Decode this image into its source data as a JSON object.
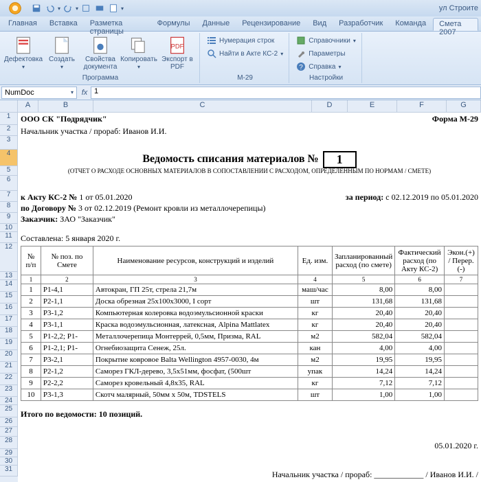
{
  "titlebar": {
    "filename": "ул Строите"
  },
  "tabs": [
    "Главная",
    "Вставка",
    "Разметка страницы",
    "Формулы",
    "Данные",
    "Рецензирование",
    "Вид",
    "Разработчик",
    "Команда",
    "Смета 2007"
  ],
  "active_tab": 9,
  "ribbon": {
    "group1": {
      "label": "Программа",
      "btns": [
        "Дефектовка",
        "Создать",
        "Свойства документа",
        "Копировать",
        "Экспорт в PDF"
      ]
    },
    "group2": {
      "label": "М-29",
      "items": [
        "Нумерация строк",
        "Найти в Акте КС-2"
      ]
    },
    "group3": {
      "label": "Настройки",
      "items": [
        "Справочники",
        "Параметры",
        "Справка"
      ]
    }
  },
  "formula": {
    "name": "NumDoc",
    "fx": "fx",
    "value": "1"
  },
  "cols": [
    "A",
    "B",
    "C",
    "D",
    "E",
    "F",
    "G"
  ],
  "rows_top": [
    "",
    "1",
    "2",
    "3",
    "4",
    "5",
    "6",
    "7",
    "8",
    "9",
    "10",
    "11"
  ],
  "rows_tbl": [
    "12",
    "13",
    "14",
    "15",
    "16",
    "17",
    "18",
    "19",
    "20",
    "21",
    "22",
    "23",
    "24"
  ],
  "rows_bot": [
    "25",
    "26",
    "27",
    "28",
    "29",
    "30",
    "31"
  ],
  "org": "ООО СК \"Подрядчик\"",
  "form": "Форма М-29",
  "foreman_label": "Начальник участка / прораб:",
  "foreman_name": "Иванов И.И.",
  "title": "Ведомость списания материалов №",
  "title_num": "1",
  "subtitle": "(ОТЧЕТ О РАСХОДЕ ОСНОВНЫХ МАТЕРИАЛОВ В СОПОСТАВЛЕНИИ С РАСХОДОМ, ОПРЕДЕЛЕННЫМ ПО НОРМАМ / СМЕТЕ)",
  "akt": {
    "label": "к Акту КС-2 №",
    "num": "1",
    "date": "от 05.01.2020"
  },
  "period": {
    "label": "за период:",
    "val": "с 02.12.2019 по 05.01.2020"
  },
  "contract": {
    "label": "по Договору №",
    "num": "3",
    "date": "от 02.12.2019",
    "desc": "(Ремонт кровли из металлочерепицы)"
  },
  "customer": {
    "label": "Заказчик:",
    "val": "ЗАО \"Заказчик\""
  },
  "composed": {
    "label": "Составлена:",
    "val": "5 января 2020 г."
  },
  "th": [
    "№ п/п",
    "№ поз. по Смете",
    "Наименование ресурсов, конструкций и изделий",
    "Ед. изм.",
    "Запланированный расход (по смете)",
    "Фактический расход (по Акту КС-2)",
    "Экон.(+) / Перер.(-)"
  ],
  "numrow": [
    "1",
    "2",
    "3",
    "4",
    "5",
    "6",
    "7"
  ],
  "data": [
    [
      "1",
      "Р1-4,1",
      "Автокран, ГП 25т, стрела 21,7м",
      "маш/час",
      "8,00",
      "8,00",
      ""
    ],
    [
      "2",
      "Р2-1,1",
      "Доска обрезная 25х100х3000, I сорт",
      "шт",
      "131,68",
      "131,68",
      ""
    ],
    [
      "3",
      "Р3-1,2",
      "Компьютерная колеровка водоэмульсионной краски",
      "кг",
      "20,40",
      "20,40",
      ""
    ],
    [
      "4",
      "Р3-1,1",
      "Краска водоэмульсионная, латексная, Alpina Mattlatex",
      "кг",
      "20,40",
      "20,40",
      ""
    ],
    [
      "5",
      "Р1-2,2; Р1-",
      "Металлочерепица Монтеррей, 0,5мм, Призма, RAL",
      "м2",
      "582,04",
      "582,04",
      ""
    ],
    [
      "6",
      "Р1-2,1; Р1-",
      "Огнебиозащита Сенеж, 25л.",
      "кан",
      "4,00",
      "4,00",
      ""
    ],
    [
      "7",
      "Р3-2,1",
      "Покрытие ковровое Balta Wellington 4957-0030, 4м",
      "м2",
      "19,95",
      "19,95",
      ""
    ],
    [
      "8",
      "Р2-1,2",
      "Саморез ГКЛ-дерево, 3,5х51мм, фосфат, (500шт",
      "упак",
      "14,24",
      "14,24",
      ""
    ],
    [
      "9",
      "Р2-2,2",
      "Саморез кровельный 4,8х35, RAL",
      "кг",
      "7,12",
      "7,12",
      ""
    ],
    [
      "10",
      "Р3-1,3",
      "Скотч малярный, 50мм х 50м, TDSTELS",
      "шт",
      "1,00",
      "1,00",
      ""
    ]
  ],
  "total": "Итого по ведомости:  10 позиций.",
  "sign_date": "05.01.2020 г.",
  "sign_label": "Начальник участка / прораб:",
  "sign_name": "/ Иванов И.И. /"
}
